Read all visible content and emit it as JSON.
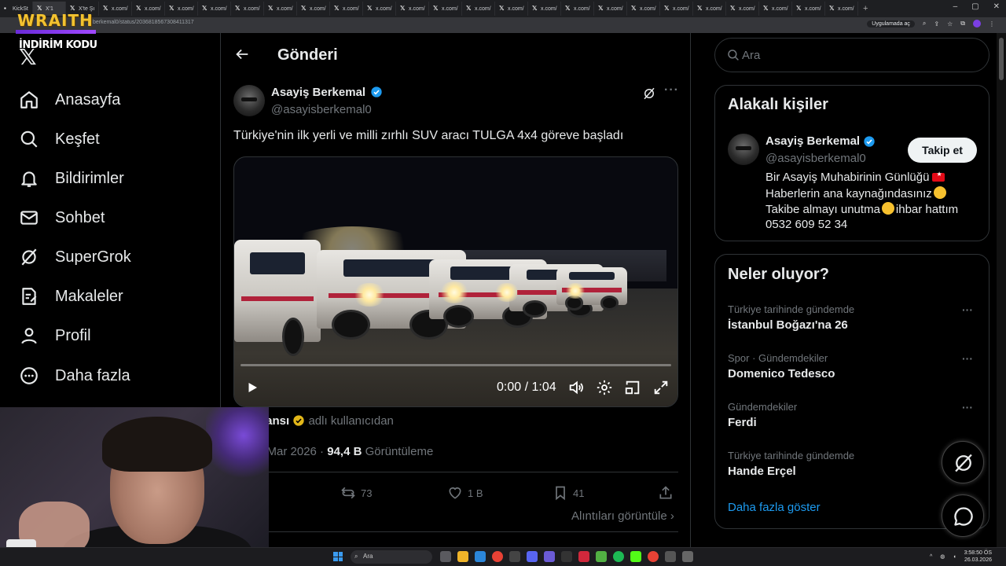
{
  "browser": {
    "tabs": [
      {
        "label": "KickSt"
      },
      {
        "label": "X'1"
      },
      {
        "label": "X'te Şı"
      },
      {
        "label": "x.com/"
      },
      {
        "label": "x.com/"
      },
      {
        "label": "x.com/"
      },
      {
        "label": "x.com/"
      },
      {
        "label": "x.com/"
      },
      {
        "label": "x.com/"
      },
      {
        "label": "x.com/"
      },
      {
        "label": "x.com/"
      },
      {
        "label": "x.com/"
      },
      {
        "label": "x.com/"
      },
      {
        "label": "x.com/"
      },
      {
        "label": "x.com/"
      },
      {
        "label": "x.com/"
      },
      {
        "label": "x.com/"
      },
      {
        "label": "x.com/"
      },
      {
        "label": "x.com/"
      },
      {
        "label": "x.com/"
      },
      {
        "label": "x.com/"
      },
      {
        "label": "x.com/"
      },
      {
        "label": "x.com/"
      },
      {
        "label": "x.com/"
      },
      {
        "label": "x.com/"
      },
      {
        "label": "x.com/"
      }
    ],
    "new_tab": "+",
    "url": "berkemal0/status/2036818567308411317",
    "app_chip": "Uygulamada aç"
  },
  "overlay": {
    "brand": "WRAITH",
    "promo": "İNDİRİM KODU"
  },
  "nav": {
    "logo": "𝕏",
    "items": [
      {
        "label": "Anasayfa",
        "icon": "home-icon"
      },
      {
        "label": "Keşfet",
        "icon": "search-icon"
      },
      {
        "label": "Bildirimler",
        "icon": "bell-icon"
      },
      {
        "label": "Sohbet",
        "icon": "mail-icon"
      },
      {
        "label": "SuperGrok",
        "icon": "grok-icon"
      },
      {
        "label": "Makaleler",
        "icon": "article-icon"
      },
      {
        "label": "Profil",
        "icon": "person-icon"
      },
      {
        "label": "Daha fazla",
        "icon": "more-circle-icon"
      }
    ]
  },
  "main": {
    "title": "Gönderi",
    "author": {
      "name": "Asayiş Berkemal",
      "handle": "@asayisberkemal0"
    },
    "text": "Türkiye'nin ilk yerli ve milli zırhlı SUV aracı TULGA 4x4 göreve başladı",
    "video": {
      "time": "0:00 / 1:04",
      "progress": 0.0
    },
    "quote_source": {
      "name": "olu Ajansı",
      "suffix": "adlı kullanıcıdan"
    },
    "meta": {
      "time": "2 · 25 Mar 2026 ·",
      "views": "94,4 B",
      "views_label": "Görüntüleme"
    },
    "actions": {
      "retweets": "73",
      "likes": "1 B",
      "bookmarks": "41"
    },
    "quotes_link": "Alıntıları görüntüle"
  },
  "right": {
    "search_placeholder": "Ara",
    "related": {
      "title": "Alakalı kişiler",
      "name": "Asayiş Berkemal",
      "handle": "@asayisberkemal0",
      "follow": "Takip et",
      "bio": [
        "Bir Asayiş Muhabirinin Günlüğü",
        "Haberlerin ana kaynağındasınız",
        "Takibe almayı unutma",
        "ihbar hattım",
        "0532 609 52 34"
      ]
    },
    "trends": {
      "title": "Neler oluyor?",
      "items": [
        {
          "category": "Türkiye tarihinde gündemde",
          "name": "İstanbul Boğazı'na 26"
        },
        {
          "category": "Spor · Gündemdekiler",
          "name": "Domenico Tedesco"
        },
        {
          "category": "Gündemdekiler",
          "name": "Ferdi"
        },
        {
          "category": "Türkiye tarihinde gündemde",
          "name": "Hande Erçel"
        }
      ],
      "show_more": "Daha fazla göster"
    }
  },
  "taskbar": {
    "search": "Ara",
    "time": "3:58:50 ÖS",
    "date": "26.03.2026"
  },
  "colors": {
    "accent": "#1d9bf0",
    "verified": "#1d9bf0",
    "gold_badge": "#e2b719",
    "overlay_gold": "#f2c230",
    "overlay_purple": "#7b3fe4"
  }
}
